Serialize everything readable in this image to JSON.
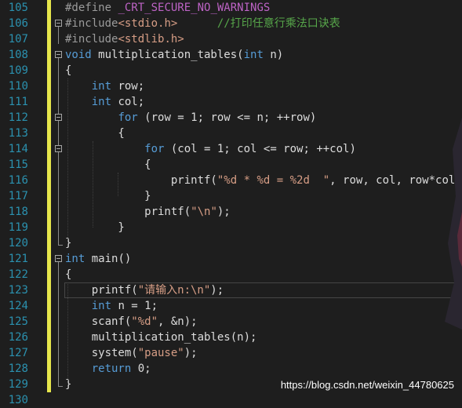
{
  "editor": {
    "colors": {
      "background": "#1e1e1e",
      "line_number": "#2b91af",
      "keyword": "#569cd6",
      "string": "#d69d85",
      "comment": "#57a64a",
      "macro": "#bd63c5",
      "preprocessor": "#9b9b9b",
      "plain": "#dcdcdc",
      "change_bar": "#e6e64c"
    },
    "lines": [
      {
        "num": "105",
        "tokens": [
          {
            "t": "#define ",
            "c": "pp"
          },
          {
            "t": "_CRT_SECURE_NO_WARNINGS",
            "c": "macro"
          }
        ]
      },
      {
        "num": "106",
        "tokens": [
          {
            "t": "#include",
            "c": "pp"
          },
          {
            "t": "<stdio.h>",
            "c": "str"
          },
          {
            "t": "      ",
            "c": "plain"
          },
          {
            "t": "//打印任意行乘法口诀表",
            "c": "cmt"
          }
        ]
      },
      {
        "num": "107",
        "tokens": [
          {
            "t": "#include",
            "c": "pp"
          },
          {
            "t": "<stdlib.h>",
            "c": "str"
          }
        ]
      },
      {
        "num": "108",
        "tokens": [
          {
            "t": "void",
            "c": "kw"
          },
          {
            "t": " multiplication_tables(",
            "c": "plain"
          },
          {
            "t": "int",
            "c": "kw"
          },
          {
            "t": " n)",
            "c": "plain"
          }
        ]
      },
      {
        "num": "109",
        "tokens": [
          {
            "t": "{",
            "c": "plain"
          }
        ]
      },
      {
        "num": "110",
        "tokens": [
          {
            "t": "    ",
            "c": "plain"
          },
          {
            "t": "int",
            "c": "kw"
          },
          {
            "t": " row;",
            "c": "plain"
          }
        ]
      },
      {
        "num": "111",
        "tokens": [
          {
            "t": "    ",
            "c": "plain"
          },
          {
            "t": "int",
            "c": "kw"
          },
          {
            "t": " col;",
            "c": "plain"
          }
        ]
      },
      {
        "num": "112",
        "tokens": [
          {
            "t": "        ",
            "c": "plain"
          },
          {
            "t": "for",
            "c": "kw"
          },
          {
            "t": " (row = 1; row <= n; ++row)",
            "c": "plain"
          }
        ]
      },
      {
        "num": "113",
        "tokens": [
          {
            "t": "        {",
            "c": "plain"
          }
        ]
      },
      {
        "num": "114",
        "tokens": [
          {
            "t": "            ",
            "c": "plain"
          },
          {
            "t": "for",
            "c": "kw"
          },
          {
            "t": " (col = 1; col <= row; ++col)",
            "c": "plain"
          }
        ]
      },
      {
        "num": "115",
        "tokens": [
          {
            "t": "            {",
            "c": "plain"
          }
        ]
      },
      {
        "num": "116",
        "tokens": [
          {
            "t": "                printf(",
            "c": "plain"
          },
          {
            "t": "\"%d * %d = %2d  \"",
            "c": "str"
          },
          {
            "t": ", row, col, row*col);",
            "c": "plain"
          }
        ]
      },
      {
        "num": "117",
        "tokens": [
          {
            "t": "            }",
            "c": "plain"
          }
        ]
      },
      {
        "num": "118",
        "tokens": [
          {
            "t": "            printf(",
            "c": "plain"
          },
          {
            "t": "\"\\n\"",
            "c": "str"
          },
          {
            "t": ");",
            "c": "plain"
          }
        ]
      },
      {
        "num": "119",
        "tokens": [
          {
            "t": "        }",
            "c": "plain"
          }
        ]
      },
      {
        "num": "120",
        "tokens": [
          {
            "t": "}",
            "c": "plain"
          }
        ]
      },
      {
        "num": "121",
        "tokens": [
          {
            "t": "int",
            "c": "kw"
          },
          {
            "t": " main()",
            "c": "plain"
          }
        ]
      },
      {
        "num": "122",
        "tokens": [
          {
            "t": "{",
            "c": "plain"
          }
        ]
      },
      {
        "num": "123",
        "tokens": [
          {
            "t": "    printf(",
            "c": "plain"
          },
          {
            "t": "\"请输入n:\\n\"",
            "c": "str"
          },
          {
            "t": ");",
            "c": "plain"
          }
        ]
      },
      {
        "num": "124",
        "tokens": [
          {
            "t": "    ",
            "c": "plain"
          },
          {
            "t": "int",
            "c": "kw"
          },
          {
            "t": " n = 1;",
            "c": "plain"
          }
        ]
      },
      {
        "num": "125",
        "tokens": [
          {
            "t": "    scanf(",
            "c": "plain"
          },
          {
            "t": "\"%d\"",
            "c": "str"
          },
          {
            "t": ", &n);",
            "c": "plain"
          }
        ]
      },
      {
        "num": "126",
        "tokens": [
          {
            "t": "    multiplication_tables(n);",
            "c": "plain"
          }
        ]
      },
      {
        "num": "127",
        "tokens": [
          {
            "t": "    system(",
            "c": "plain"
          },
          {
            "t": "\"pause\"",
            "c": "str"
          },
          {
            "t": ");",
            "c": "plain"
          }
        ]
      },
      {
        "num": "128",
        "tokens": [
          {
            "t": "    ",
            "c": "plain"
          },
          {
            "t": "return",
            "c": "kw"
          },
          {
            "t": " 0;",
            "c": "plain"
          }
        ]
      },
      {
        "num": "129",
        "tokens": [
          {
            "t": "}",
            "c": "plain"
          }
        ]
      },
      {
        "num": "130",
        "tokens": []
      }
    ]
  },
  "watermark": "https://blog.csdn.net/weixin_44780625"
}
